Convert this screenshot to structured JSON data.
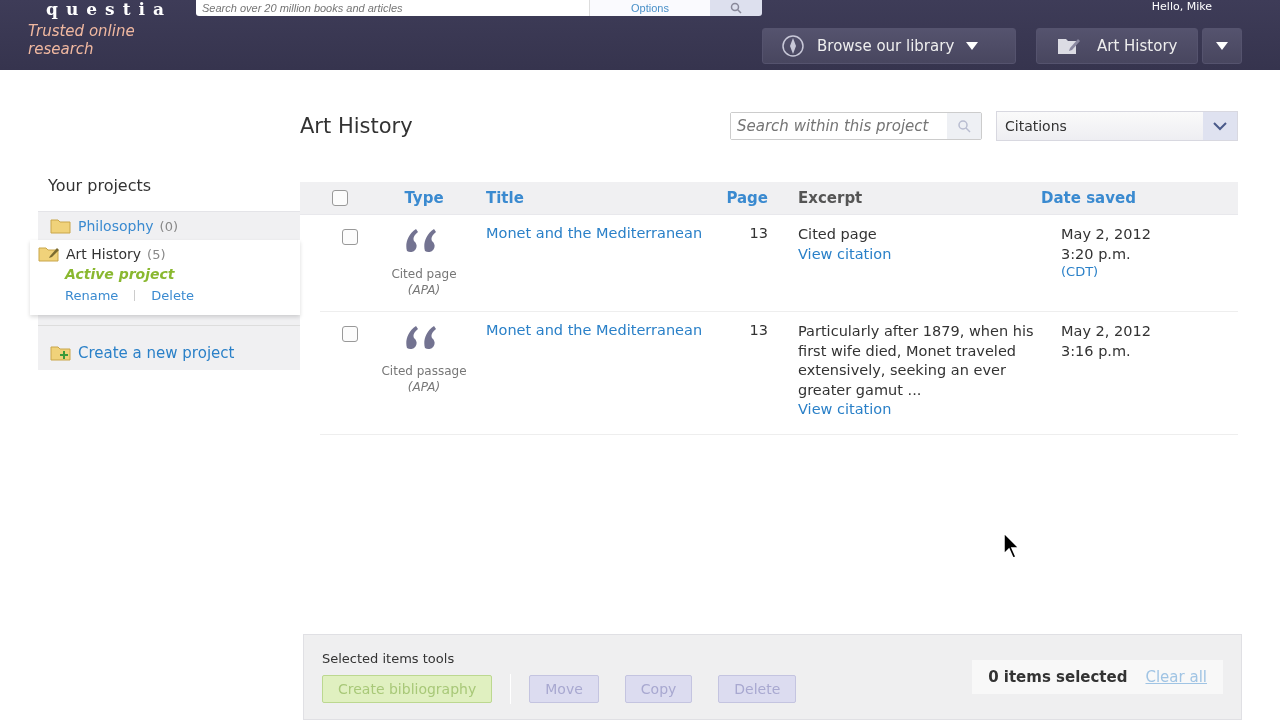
{
  "header": {
    "logo": "questia",
    "tagline": "Trusted online research",
    "search": {
      "placeholder": "Search over 20 million books and articles"
    },
    "options": "Options",
    "greeting": "Hello, Mike",
    "menus": [
      {
        "kind": "browse",
        "label": "Browse our library"
      },
      {
        "kind": "project",
        "label": "Art History"
      }
    ]
  },
  "sidebar": {
    "title": "Your projects",
    "projects": [
      {
        "name": "Philosophy",
        "count": "(0)",
        "active": false
      },
      {
        "name": "Art History",
        "count": "(5)",
        "active": true,
        "status": "Active project",
        "actions": [
          "Rename",
          "Delete"
        ]
      }
    ],
    "create": "Create a new project"
  },
  "project": {
    "title": "Art History",
    "search": {
      "placeholder": "Search within this project"
    },
    "view": "Citations"
  },
  "table": {
    "select_all": {
      "checked": false
    },
    "columns": [
      {
        "label": "Type",
        "sortable": true
      },
      {
        "label": "Title",
        "sortable": true
      },
      {
        "label": "Page",
        "sortable": true
      },
      {
        "label": "Excerpt",
        "sortable": false
      },
      {
        "label": "Date saved",
        "sortable": true
      }
    ],
    "rows": [
      {
        "checked": false,
        "type": "Cited page",
        "style": "(APA)",
        "title": "Monet and the Mediterranean",
        "page": "13",
        "excerpt": "Cited page",
        "link": "View citation",
        "date": "May 2, 2012",
        "time": "3:20 p.m.",
        "zone": "(CDT)"
      },
      {
        "checked": false,
        "type": "Cited passage",
        "style": "(APA)",
        "title": "Monet and the Mediterranean",
        "page": "13",
        "excerpt": "Particularly after 1879, when his first wife died, Monet traveled extensively, seeking an ever greater gamut ...",
        "link": "View citation",
        "date": "May 2, 2012",
        "time": "3:16 p.m."
      }
    ]
  },
  "toolbar": {
    "title": "Selected items tools",
    "buttons": [
      {
        "kind": "bibliography",
        "label": "Create bibliography",
        "disabled": true
      },
      {
        "kind": "plain",
        "label": "Move",
        "disabled": true
      },
      {
        "kind": "plain",
        "label": "Copy",
        "disabled": true
      },
      {
        "kind": "plain",
        "label": "Delete",
        "disabled": true
      }
    ],
    "count": "0 items selected",
    "clear": {
      "label": "Clear all",
      "disabled": true
    }
  }
}
